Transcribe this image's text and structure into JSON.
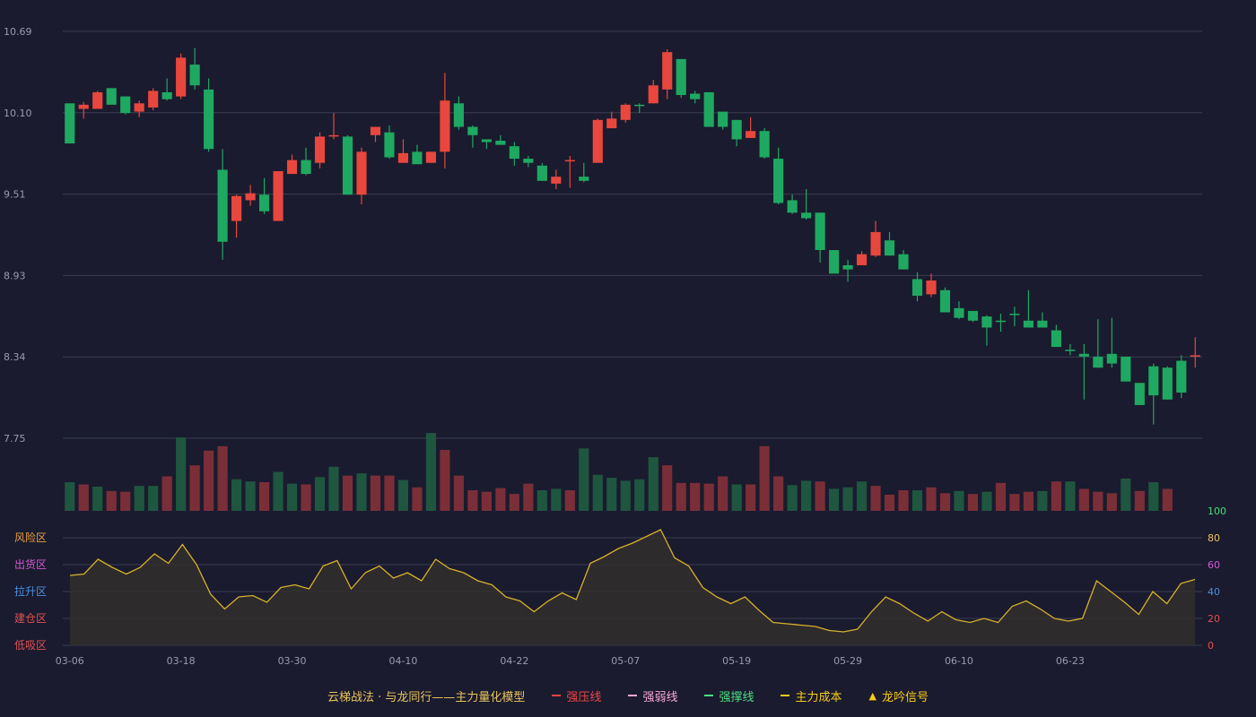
{
  "chart_data": {
    "type": "candlestick",
    "x_tick_labels": [
      "03-06",
      "03-18",
      "03-30",
      "04-10",
      "04-22",
      "05-07",
      "05-19",
      "05-29",
      "06-10",
      "06-23"
    ],
    "x_tick_index": [
      0,
      8,
      16,
      24,
      32,
      40,
      48,
      56,
      64,
      72
    ],
    "price_axis": {
      "ticks": [
        "10.69",
        "10.10",
        "9.51",
        "8.93",
        "8.34",
        "7.75"
      ],
      "range": [
        7.75,
        10.69
      ]
    },
    "candles": [
      [
        10.17,
        9.88,
        10.17,
        9.88
      ],
      [
        10.13,
        10.16,
        10.18,
        10.06
      ],
      [
        10.13,
        10.25,
        10.26,
        10.13
      ],
      [
        10.28,
        10.16,
        10.28,
        10.16
      ],
      [
        10.22,
        10.1,
        10.22,
        10.09
      ],
      [
        10.11,
        10.17,
        10.19,
        10.07
      ],
      [
        10.14,
        10.26,
        10.28,
        10.12
      ],
      [
        10.25,
        10.2,
        10.35,
        10.19
      ],
      [
        10.22,
        10.5,
        10.53,
        10.2
      ],
      [
        10.45,
        10.3,
        10.57,
        10.27
      ],
      [
        10.27,
        9.84,
        10.35,
        9.82
      ],
      [
        9.69,
        9.17,
        9.84,
        9.04
      ],
      [
        9.32,
        9.5,
        9.51,
        9.2
      ],
      [
        9.47,
        9.52,
        9.58,
        9.43
      ],
      [
        9.51,
        9.39,
        9.63,
        9.37
      ],
      [
        9.32,
        9.68,
        9.68,
        9.32
      ],
      [
        9.66,
        9.76,
        9.8,
        9.66
      ],
      [
        9.76,
        9.66,
        9.85,
        9.65
      ],
      [
        9.74,
        9.93,
        9.96,
        9.7
      ],
      [
        9.93,
        9.94,
        10.1,
        9.91
      ],
      [
        9.93,
        9.51,
        9.94,
        9.51
      ],
      [
        9.51,
        9.82,
        9.85,
        9.44
      ],
      [
        9.94,
        10.0,
        10.0,
        9.89
      ],
      [
        9.96,
        9.78,
        10.01,
        9.77
      ],
      [
        9.74,
        9.81,
        9.91,
        9.74
      ],
      [
        9.82,
        9.73,
        9.87,
        9.78
      ],
      [
        9.74,
        9.82,
        9.82,
        9.74
      ],
      [
        9.82,
        10.19,
        10.39,
        9.7
      ],
      [
        10.17,
        10.0,
        10.22,
        9.98
      ],
      [
        10.0,
        9.94,
        10.01,
        9.85
      ],
      [
        9.91,
        9.89,
        9.91,
        9.84
      ],
      [
        9.9,
        9.87,
        9.94,
        9.87
      ],
      [
        9.86,
        9.77,
        9.89,
        9.72
      ],
      [
        9.77,
        9.74,
        9.79,
        9.71
      ],
      [
        9.72,
        9.61,
        9.74,
        9.61
      ],
      [
        9.59,
        9.64,
        9.69,
        9.55
      ],
      [
        9.76,
        9.76,
        9.79,
        9.56
      ],
      [
        9.64,
        9.61,
        9.74,
        9.6
      ],
      [
        9.74,
        10.05,
        10.06,
        9.75
      ],
      [
        9.99,
        10.06,
        10.11,
        9.99
      ],
      [
        10.05,
        10.16,
        10.17,
        10.03
      ],
      [
        10.16,
        10.15,
        10.17,
        10.1
      ],
      [
        10.17,
        10.3,
        10.34,
        10.17
      ],
      [
        10.27,
        10.54,
        10.56,
        10.2
      ],
      [
        10.49,
        10.23,
        10.49,
        10.21
      ],
      [
        10.24,
        10.2,
        10.26,
        10.17
      ],
      [
        10.25,
        10.0,
        10.25,
        10.0
      ],
      [
        10.11,
        10.0,
        10.1,
        9.98
      ],
      [
        10.05,
        9.91,
        10.05,
        9.86
      ],
      [
        9.92,
        9.97,
        10.07,
        9.92
      ],
      [
        9.97,
        9.78,
        9.99,
        9.77
      ],
      [
        9.77,
        9.45,
        9.85,
        9.44
      ],
      [
        9.47,
        9.38,
        9.51,
        9.37
      ],
      [
        9.38,
        9.34,
        9.55,
        9.33
      ],
      [
        9.38,
        9.11,
        9.38,
        9.02
      ],
      [
        9.11,
        8.94,
        9.11,
        8.94
      ],
      [
        9.0,
        8.97,
        9.04,
        8.88
      ],
      [
        9.0,
        9.08,
        9.1,
        9.0
      ],
      [
        9.07,
        9.24,
        9.32,
        9.06
      ],
      [
        9.18,
        9.07,
        9.24,
        9.07
      ],
      [
        9.08,
        8.97,
        9.11,
        8.97
      ],
      [
        8.9,
        8.78,
        8.95,
        8.74
      ],
      [
        8.79,
        8.89,
        8.94,
        8.77
      ],
      [
        8.82,
        8.66,
        8.84,
        8.67
      ],
      [
        8.69,
        8.62,
        8.74,
        8.61
      ],
      [
        8.67,
        8.6,
        8.67,
        8.59
      ],
      [
        8.63,
        8.55,
        8.64,
        8.42
      ],
      [
        8.6,
        8.59,
        8.65,
        8.52
      ],
      [
        8.65,
        8.64,
        8.7,
        8.56
      ],
      [
        8.6,
        8.55,
        8.82,
        8.6
      ],
      [
        8.6,
        8.55,
        8.66,
        8.55
      ],
      [
        8.53,
        8.41,
        8.57,
        8.41
      ],
      [
        8.39,
        8.38,
        8.43,
        8.35
      ],
      [
        8.36,
        8.34,
        8.43,
        8.03
      ],
      [
        8.34,
        8.26,
        8.61,
        8.26
      ],
      [
        8.36,
        8.29,
        8.62,
        8.26
      ],
      [
        8.34,
        8.16,
        8.34,
        8.16
      ],
      [
        8.15,
        7.99,
        8.15,
        7.99
      ],
      [
        8.27,
        8.06,
        8.29,
        7.85
      ],
      [
        8.26,
        8.03,
        8.27,
        8.03
      ],
      [
        8.31,
        8.08,
        8.35,
        8.04
      ],
      [
        8.34,
        8.35,
        8.48,
        8.26
      ]
    ],
    "volume": [
      [
        39,
        "g"
      ],
      [
        36,
        "r"
      ],
      [
        33,
        "g"
      ],
      [
        27,
        "r"
      ],
      [
        26,
        "r"
      ],
      [
        34,
        "g"
      ],
      [
        34,
        "g"
      ],
      [
        47,
        "r"
      ],
      [
        100,
        "g"
      ],
      [
        62,
        "r"
      ],
      [
        82,
        "r"
      ],
      [
        88,
        "r"
      ],
      [
        43,
        "g"
      ],
      [
        40,
        "g"
      ],
      [
        39,
        "r"
      ],
      [
        53,
        "g"
      ],
      [
        37,
        "g"
      ],
      [
        36,
        "r"
      ],
      [
        46,
        "g"
      ],
      [
        60,
        "g"
      ],
      [
        48,
        "r"
      ],
      [
        51,
        "g"
      ],
      [
        48,
        "r"
      ],
      [
        48,
        "r"
      ],
      [
        42,
        "g"
      ],
      [
        32,
        "r"
      ],
      [
        106,
        "g"
      ],
      [
        83,
        "r"
      ],
      [
        48,
        "r"
      ],
      [
        28,
        "r"
      ],
      [
        26,
        "r"
      ],
      [
        31,
        "r"
      ],
      [
        23,
        "r"
      ],
      [
        37,
        "r"
      ],
      [
        28,
        "g"
      ],
      [
        30,
        "g"
      ],
      [
        28,
        "r"
      ],
      [
        85,
        "g"
      ],
      [
        49,
        "g"
      ],
      [
        45,
        "g"
      ],
      [
        41,
        "g"
      ],
      [
        43,
        "g"
      ],
      [
        73,
        "g"
      ],
      [
        62,
        "r"
      ],
      [
        38,
        "r"
      ],
      [
        38,
        "r"
      ],
      [
        37,
        "r"
      ],
      [
        47,
        "r"
      ],
      [
        36,
        "g"
      ],
      [
        36,
        "r"
      ],
      [
        88,
        "r"
      ],
      [
        47,
        "r"
      ],
      [
        35,
        "g"
      ],
      [
        41,
        "g"
      ],
      [
        40,
        "r"
      ],
      [
        30,
        "g"
      ],
      [
        32,
        "g"
      ],
      [
        40,
        "g"
      ],
      [
        34,
        "r"
      ],
      [
        22,
        "r"
      ],
      [
        28,
        "r"
      ],
      [
        28,
        "g"
      ],
      [
        32,
        "r"
      ],
      [
        24,
        "r"
      ],
      [
        27,
        "g"
      ],
      [
        23,
        "r"
      ],
      [
        26,
        "g"
      ],
      [
        38,
        "r"
      ],
      [
        23,
        "r"
      ],
      [
        26,
        "r"
      ],
      [
        27,
        "g"
      ],
      [
        40,
        "r"
      ],
      [
        40,
        "g"
      ],
      [
        30,
        "r"
      ],
      [
        26,
        "r"
      ],
      [
        24,
        "r"
      ],
      [
        44,
        "g"
      ],
      [
        27,
        "r"
      ],
      [
        39,
        "g"
      ],
      [
        30,
        "r"
      ]
    ],
    "indicator": {
      "values": [
        52,
        53,
        64,
        58,
        53,
        58,
        68,
        61,
        75,
        60,
        38,
        27,
        36,
        37,
        32,
        43,
        45,
        42,
        59,
        63,
        42,
        54,
        59,
        50,
        54,
        48,
        64,
        57,
        54,
        48,
        45,
        36,
        33,
        25,
        33,
        39,
        34,
        61,
        66,
        72,
        76,
        81,
        86,
        65,
        59,
        43,
        36,
        31,
        36,
        26,
        17,
        16,
        15,
        14,
        11,
        10,
        12,
        25,
        36,
        31,
        24,
        18,
        25,
        19,
        17,
        20,
        17,
        29,
        33,
        27,
        20,
        18,
        20,
        48,
        40,
        32,
        23,
        40,
        31,
        46,
        49
      ],
      "left_zones": [
        "风险区",
        "出货区",
        "拉升区",
        "建仓区",
        "低吸区"
      ],
      "right_ticks": [
        "100",
        "80",
        "60",
        "40",
        "20",
        "0"
      ],
      "range": [
        0,
        100
      ]
    },
    "legend": [
      {
        "label": "云梯战法 · 与龙同行——主力量化模型",
        "color": "#e8c45a",
        "kind": "title"
      },
      {
        "label": "强压线",
        "color": "#ef4444",
        "kind": "solid"
      },
      {
        "label": "强弱线",
        "color": "#f9a8d4",
        "kind": "dashed"
      },
      {
        "label": "强撑线",
        "color": "#4ade80",
        "kind": "solid"
      },
      {
        "label": "主力成本",
        "color": "#facc15",
        "kind": "dashed"
      },
      {
        "label": "龙吟信号",
        "color": "#facc15",
        "kind": "triangle"
      }
    ],
    "colors": {
      "background": "#1a1b2e",
      "up": "#e8473e",
      "down": "#1fa861",
      "vol_up": "#7a2f38",
      "vol_down": "#1f5640",
      "grid": "#3a3c52",
      "axis_text": "#9a9cab",
      "indicator_line": "#d4b12a",
      "indicator_fill": "#332e2c"
    },
    "zone_colors": [
      "#e8a040",
      "#d05ad0",
      "#4a90e0",
      "#e05050",
      "#e05050"
    ],
    "right_tick_colors": [
      "#4ade80",
      "#e8c45a",
      "#d05ad0",
      "#4a90e0",
      "#e05050",
      "#e05050"
    ]
  }
}
